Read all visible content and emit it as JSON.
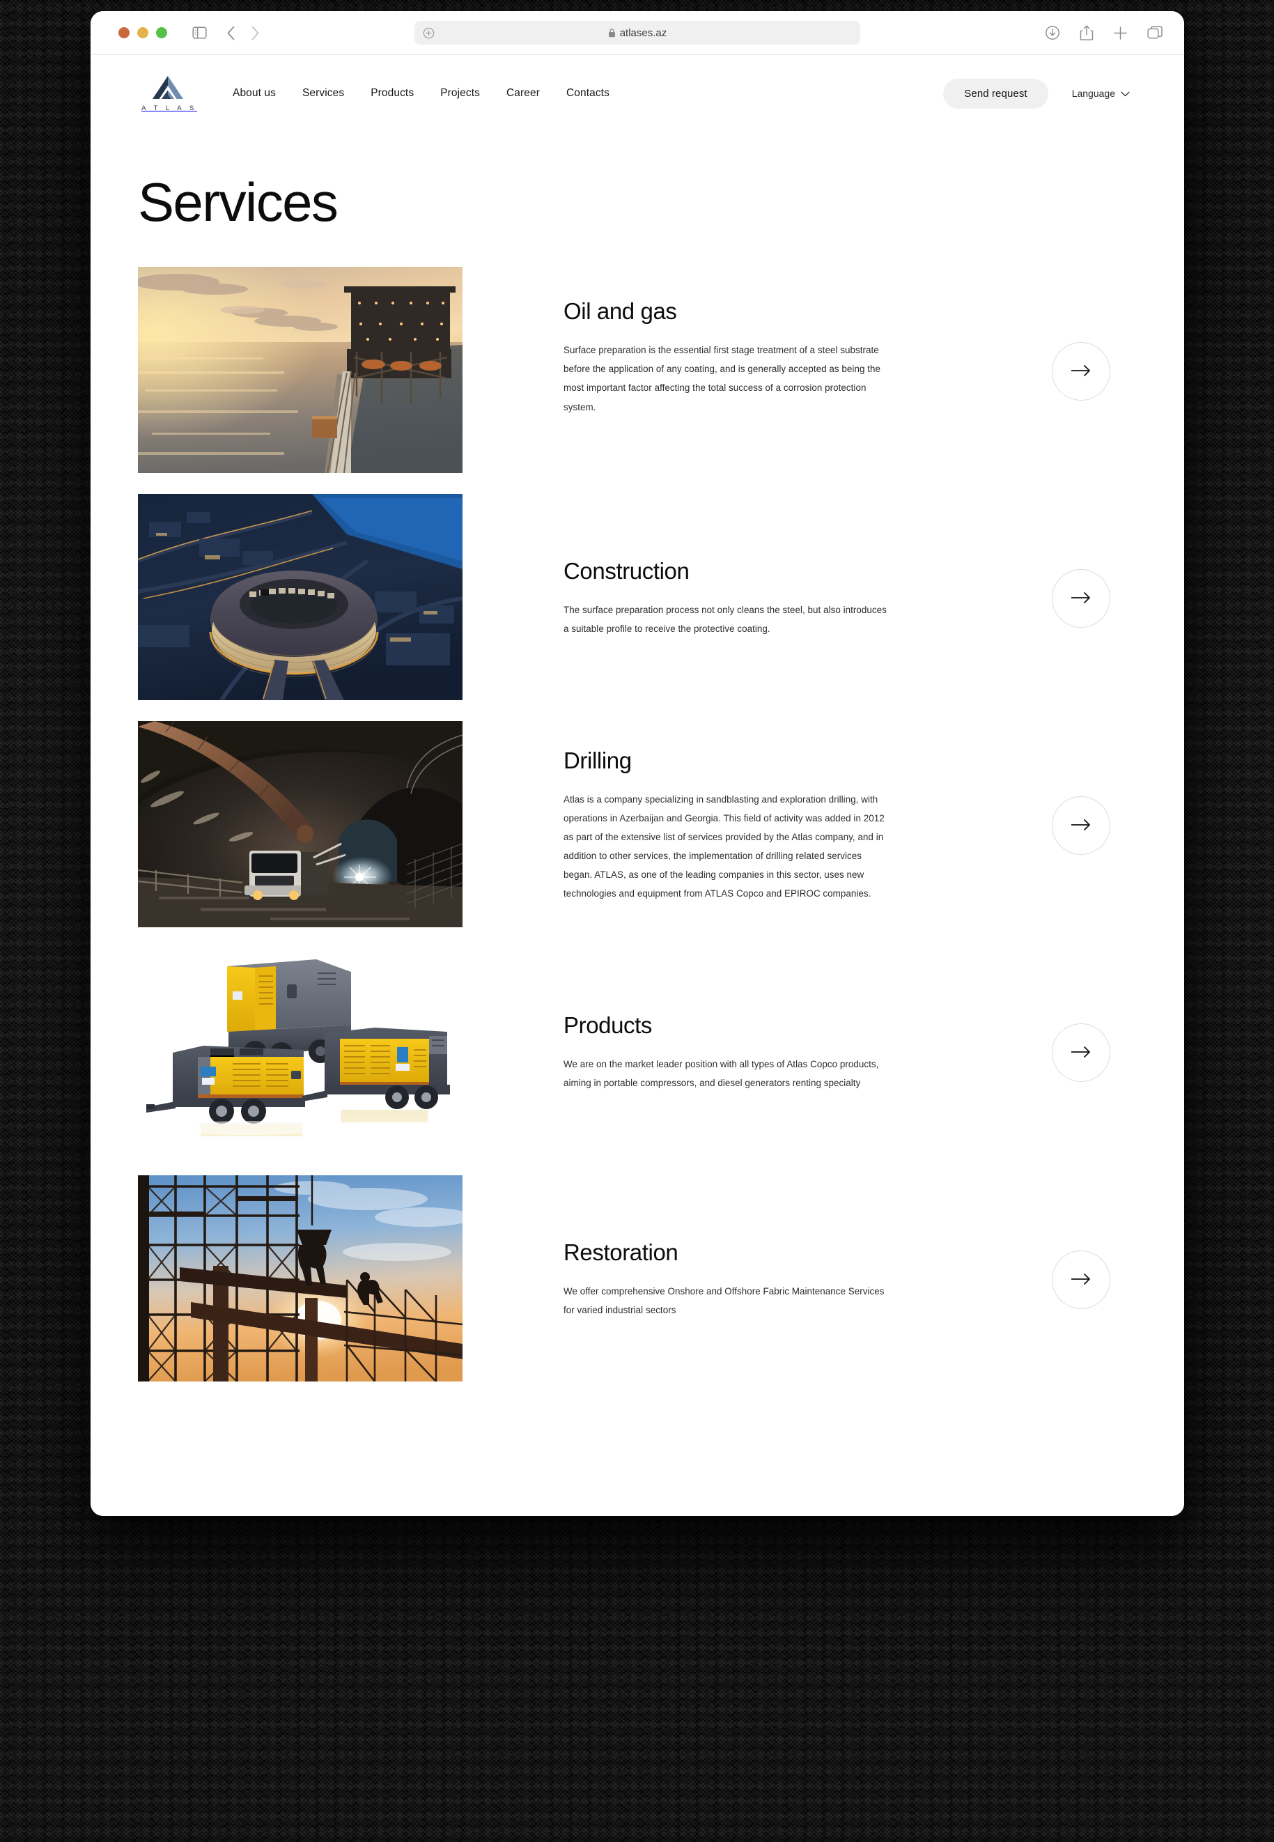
{
  "browser": {
    "url": "atlases.az",
    "secure": true,
    "window_controls": [
      "close",
      "minimize",
      "zoom"
    ],
    "toolbar_icons": [
      "sidebar-icon",
      "back-icon",
      "forward-icon",
      "reader-icon",
      "lock-icon",
      "downloads-icon",
      "share-icon",
      "new-tab-icon",
      "tab-overview-icon"
    ]
  },
  "site": {
    "brand": {
      "wordmark": "A T L A S",
      "mark_colors": {
        "dark": "#27364d",
        "light": "#6f8cae"
      }
    },
    "nav": [
      {
        "label": "About us"
      },
      {
        "label": "Services"
      },
      {
        "label": "Products"
      },
      {
        "label": "Projects"
      },
      {
        "label": "Career"
      },
      {
        "label": "Contacts"
      }
    ],
    "cta": {
      "label": "Send request"
    },
    "language": {
      "label": "Language",
      "chevron": "chevron-down-icon"
    }
  },
  "page": {
    "title": "Services",
    "services": [
      {
        "id": "oil-and-gas",
        "title": "Oil and gas",
        "description": "Surface preparation is the essential first stage treatment of a steel substrate before the application of any coating, and is generally accepted as being the most important factor affecting the total success of a corrosion protection system.",
        "image_alt": "Offshore oil platform at sunset",
        "arrow": "arrow-right-icon"
      },
      {
        "id": "construction",
        "title": "Construction",
        "description": "The surface preparation process not only cleans the steel, but also introduces a suitable profile to receive the protective coating.",
        "image_alt": "Aerial night view of Baku Olympic Stadium",
        "arrow": "arrow-right-icon"
      },
      {
        "id": "drilling",
        "title": "Drilling",
        "description": "Atlas is a company specializing in sandblasting and exploration drilling, with operations in Azerbaijan and Georgia. This field of activity was added in 2012 as part of the extensive list of services provided by the Atlas company, and in addition to other services, the implementation of drilling related services began. ATLAS, as one of the leading companies in this sector, uses new technologies and equipment from ATLAS Copco and EPIROC companies.",
        "image_alt": "Truck inside a lit excavation tunnel",
        "arrow": "arrow-right-icon"
      },
      {
        "id": "products",
        "title": "Products",
        "description": "We are on the market leader position with all types of Atlas Copco products, aiming in portable compressors, and diesel generators renting specialty",
        "image_alt": "Yellow and grey portable air compressors on trailers",
        "arrow": "arrow-right-icon"
      },
      {
        "id": "restoration",
        "title": "Restoration",
        "description": "We offer comprehensive Onshore and Offshore Fabric Maintenance Services for varied industrial sectors",
        "image_alt": "Scaffolding silhouette against a sunset sky",
        "arrow": "arrow-right-icon"
      }
    ]
  }
}
